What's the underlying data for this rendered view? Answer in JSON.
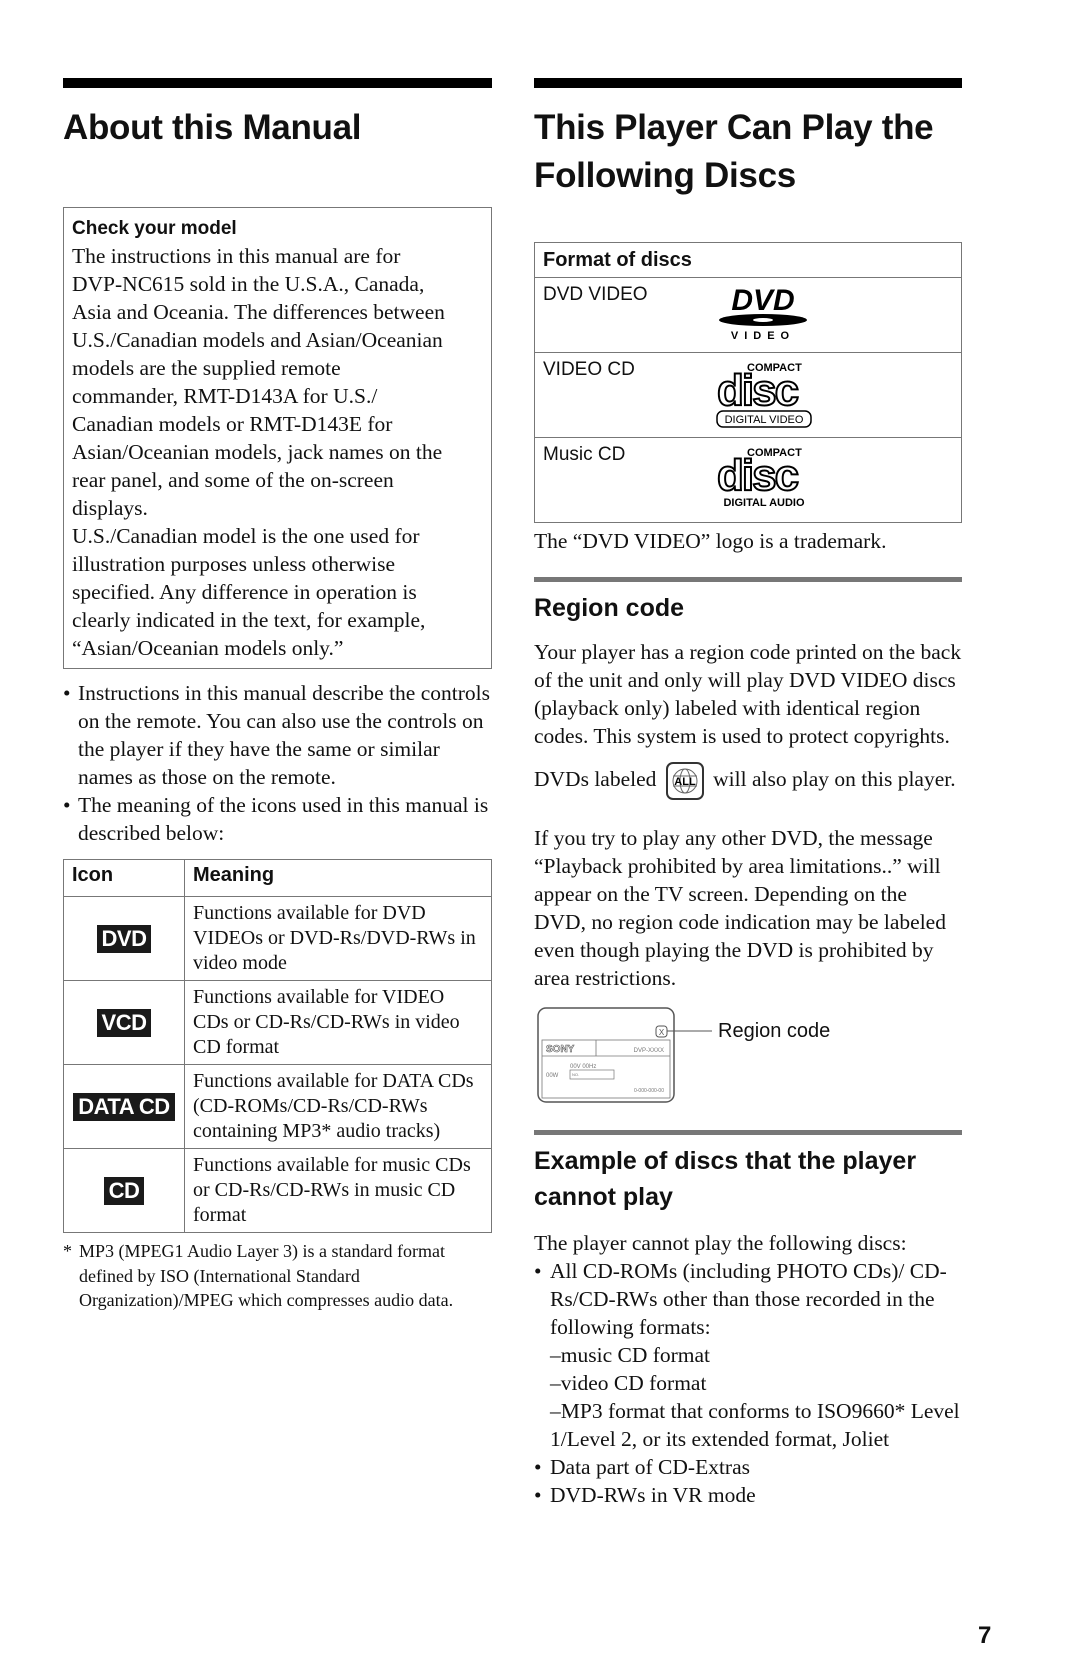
{
  "page_number": "7",
  "left": {
    "title": "About this Manual",
    "check_box": {
      "title": "Check your model",
      "lines": [
        "The instructions in this manual are for",
        "DVP-NC615 sold in the U.S.A., Canada,",
        "Asia and Oceania. The differences between",
        "U.S./Canadian models and Asian/Oceanian",
        "models are the supplied remote",
        "commander, RMT-D143A for U.S./",
        "Canadian models or RMT-D143E for",
        "Asian/Oceanian models, jack names on the",
        "rear panel, and some of the on-screen",
        "displays.",
        "U.S./Canadian model is the one used for",
        "illustration purposes unless otherwise",
        "specified. Any difference in operation is",
        "clearly indicated in the text, for example,",
        "“Asian/Oceanian models only.”"
      ]
    },
    "bullets": [
      "Instructions in this manual describe the controls on the remote. You can also use the controls on the player if they have the same or similar names as those on the remote.",
      "The meaning of the icons used in this manual is described below:"
    ],
    "icon_table": {
      "headers": [
        "Icon",
        "Meaning"
      ],
      "rows": [
        {
          "icon": "DVD",
          "icon_name": "dvd-icon",
          "meaning": "Functions available for DVD VIDEOs or DVD-Rs/DVD-RWs in video mode"
        },
        {
          "icon": "VCD",
          "icon_name": "vcd-icon",
          "meaning": "Functions available for VIDEO CDs or CD-Rs/CD-RWs in video CD format"
        },
        {
          "icon": "DATA CD",
          "icon_name": "data-cd-icon",
          "meaning": "Functions available for DATA CDs (CD-ROMs/CD-Rs/CD-RWs containing MP3* audio tracks)"
        },
        {
          "icon": "CD",
          "icon_name": "cd-icon",
          "meaning": "Functions available for music CDs or CD-Rs/CD-RWs in music CD format"
        }
      ]
    },
    "footnote_marker": "*",
    "footnote": "MP3 (MPEG1 Audio Layer 3) is a standard format defined by ISO (International Standard Organization)/MPEG which compresses audio data."
  },
  "right": {
    "title_line1": "This Player Can Play the",
    "title_line2": "Following Discs",
    "formats_table": {
      "header": "Format of discs",
      "rows": [
        {
          "name": "DVD VIDEO",
          "logo": "dvd-video-logo",
          "logo_sub": "VIDEO"
        },
        {
          "name": "VIDEO CD",
          "logo": "compact-disc-digital-video-logo",
          "logo_top": "COMPACT",
          "logo_sub": "DIGITAL VIDEO"
        },
        {
          "name": "Music CD",
          "logo": "compact-disc-digital-audio-logo",
          "logo_top": "COMPACT",
          "logo_sub": "DIGITAL AUDIO"
        }
      ]
    },
    "trademark_note": "The “DVD VIDEO” logo is a trademark.",
    "region": {
      "heading": "Region code",
      "para1": "Your player has a region code printed on the back of the unit and only will play DVD VIDEO discs (playback only) labeled with identical region codes. This system is used to protect copyrights.",
      "para2_before": "DVDs labeled",
      "all_icon_label": "ALL",
      "para2_after": "will also play on this player.",
      "para3": "If you try to play any other DVD, the message “Playback prohibited by area limitations..” will appear on the TV screen. Depending on the DVD, no region code indication may be labeled even though playing the DVD is prohibited by area restrictions.",
      "diagram": {
        "callout": "Region code",
        "region_mark": "X",
        "brand": "SONY",
        "model": "DVP-XXXX",
        "power": "00V 00Hz",
        "watts": "00W",
        "serial": "0-000-000-00",
        "no_label": "NO."
      }
    },
    "cannot_play": {
      "heading_line1": "Example of discs that the player",
      "heading_line2": "cannot play",
      "intro": "The player cannot play the following discs:",
      "item1": "All CD-ROMs (including PHOTO CDs)/ CD-Rs/CD-RWs other than those recorded in the following formats:",
      "item1_subs": [
        "–music CD format",
        "–video CD format",
        "–MP3 format that conforms to ISO9660* Level 1/Level 2, or its extended format, Joliet"
      ],
      "item2": "Data part of CD-Extras",
      "item3": "DVD-RWs in VR mode"
    }
  }
}
